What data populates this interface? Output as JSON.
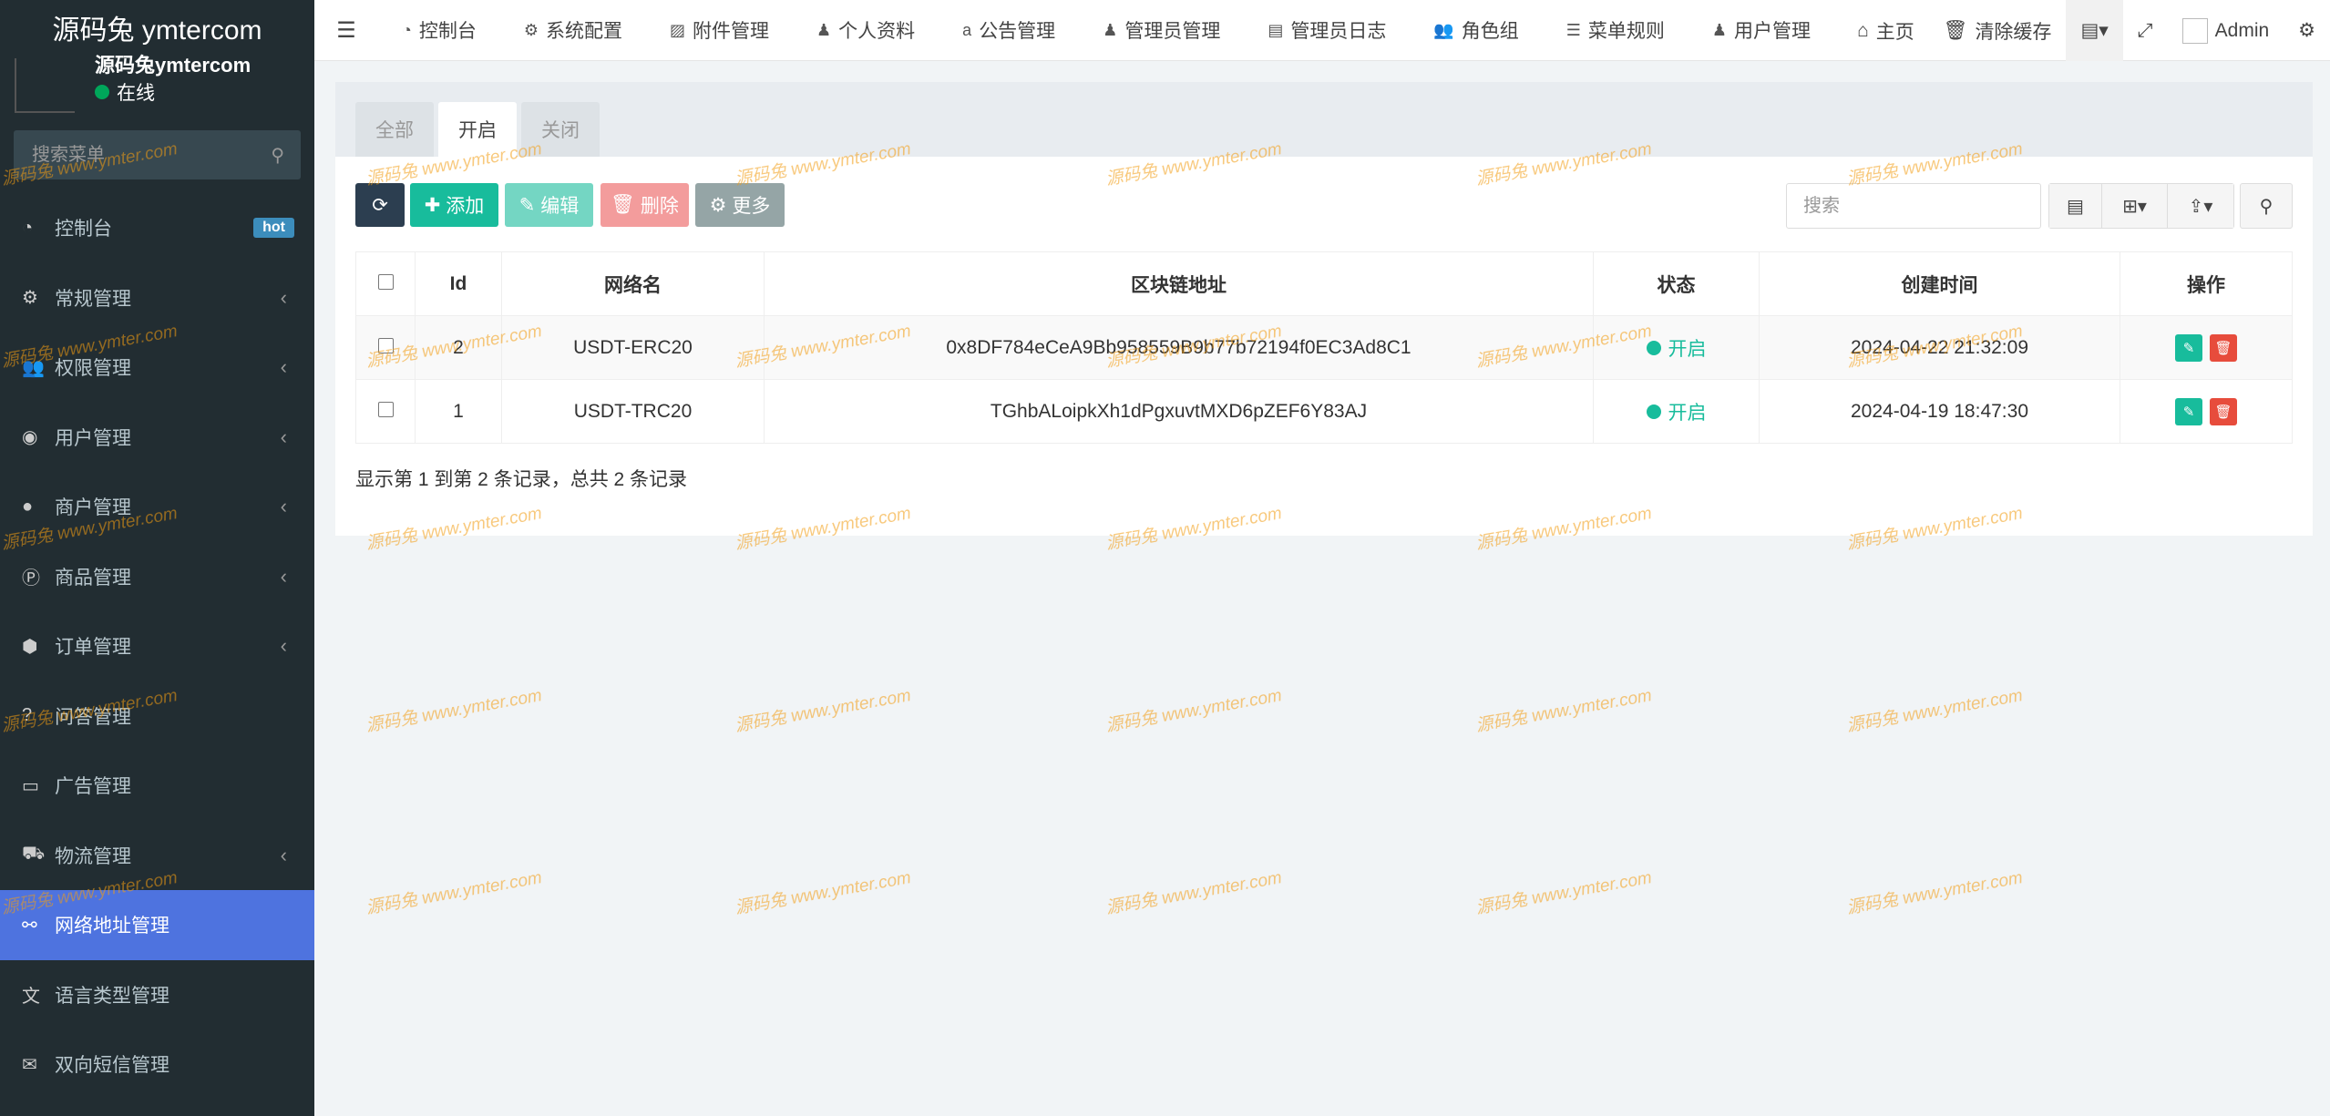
{
  "sidebar": {
    "brand": "源码兔 ymtercom",
    "user_name": "源码兔ymtercom",
    "user_status": "在线",
    "search_placeholder": "搜索菜单",
    "items": [
      {
        "label": "控制台",
        "icon": "dashboard-icon",
        "glyph": "◔",
        "badge": "hot",
        "chevron": false
      },
      {
        "label": "常规管理",
        "icon": "cogs-icon",
        "glyph": "⚙",
        "chevron": true
      },
      {
        "label": "权限管理",
        "icon": "group-icon",
        "glyph": "👥",
        "chevron": true
      },
      {
        "label": "用户管理",
        "icon": "user-circle-icon",
        "glyph": "◉",
        "chevron": true
      },
      {
        "label": "商户管理",
        "icon": "apple-icon",
        "glyph": "●",
        "chevron": true
      },
      {
        "label": "商品管理",
        "icon": "product-icon",
        "glyph": "Ⓟ",
        "chevron": true
      },
      {
        "label": "订单管理",
        "icon": "cube-icon",
        "glyph": "⬢",
        "chevron": true
      },
      {
        "label": "问答管理",
        "icon": "question-icon",
        "glyph": "?",
        "chevron": false
      },
      {
        "label": "广告管理",
        "icon": "ad-icon",
        "glyph": "▭",
        "chevron": false
      },
      {
        "label": "物流管理",
        "icon": "truck-icon",
        "glyph": "⛟",
        "chevron": true
      },
      {
        "label": "网络地址管理",
        "icon": "link-icon",
        "glyph": "⚯",
        "chevron": false,
        "active": true
      },
      {
        "label": "语言类型管理",
        "icon": "language-icon",
        "glyph": "文",
        "chevron": false
      },
      {
        "label": "双向短信管理",
        "icon": "envelope-icon",
        "glyph": "✉",
        "chevron": false
      }
    ]
  },
  "navbar": {
    "items": [
      {
        "label": "控制台",
        "icon": "dashboard-icon",
        "glyph": "◔"
      },
      {
        "label": "系统配置",
        "icon": "cog-icon",
        "glyph": "⚙"
      },
      {
        "label": "附件管理",
        "icon": "image-icon",
        "glyph": "▨"
      },
      {
        "label": "个人资料",
        "icon": "user-icon",
        "glyph": "♟"
      },
      {
        "label": "公告管理",
        "icon": "amazon-icon",
        "glyph": "a"
      },
      {
        "label": "管理员管理",
        "icon": "user-icon",
        "glyph": "♟"
      },
      {
        "label": "管理员日志",
        "icon": "list-alt-icon",
        "glyph": "▤"
      },
      {
        "label": "角色组",
        "icon": "group-icon",
        "glyph": "👥"
      },
      {
        "label": "菜单规则",
        "icon": "bars-icon",
        "glyph": "☰"
      },
      {
        "label": "用户管理",
        "icon": "user-icon",
        "glyph": "♟"
      }
    ],
    "home_label": "主页",
    "clear_cache": "清除缓存",
    "admin_label": "Admin"
  },
  "tabs": [
    {
      "label": "全部",
      "active": false
    },
    {
      "label": "开启",
      "active": true
    },
    {
      "label": "关闭",
      "active": false
    }
  ],
  "toolbar": {
    "add": "添加",
    "edit": "编辑",
    "delete": "删除",
    "more": "更多",
    "search_placeholder": "搜索"
  },
  "table": {
    "headers": [
      "Id",
      "网络名",
      "区块链地址",
      "状态",
      "创建时间",
      "操作"
    ],
    "rows": [
      {
        "id": "2",
        "name": "USDT-ERC20",
        "address": "0x8DF784eCeA9Bb958559B9b77b72194f0EC3Ad8C1",
        "status": "开启",
        "created": "2024-04-22 21:32:09"
      },
      {
        "id": "1",
        "name": "USDT-TRC20",
        "address": "TGhbALoipkXh1dPgxuvtMXD6pZEF6Y83AJ",
        "status": "开启",
        "created": "2024-04-19 18:47:30"
      }
    ]
  },
  "pager_info": "显示第 1 到第 2 条记录，总共 2 条记录",
  "watermark": "源码兔  www.ymter.com"
}
